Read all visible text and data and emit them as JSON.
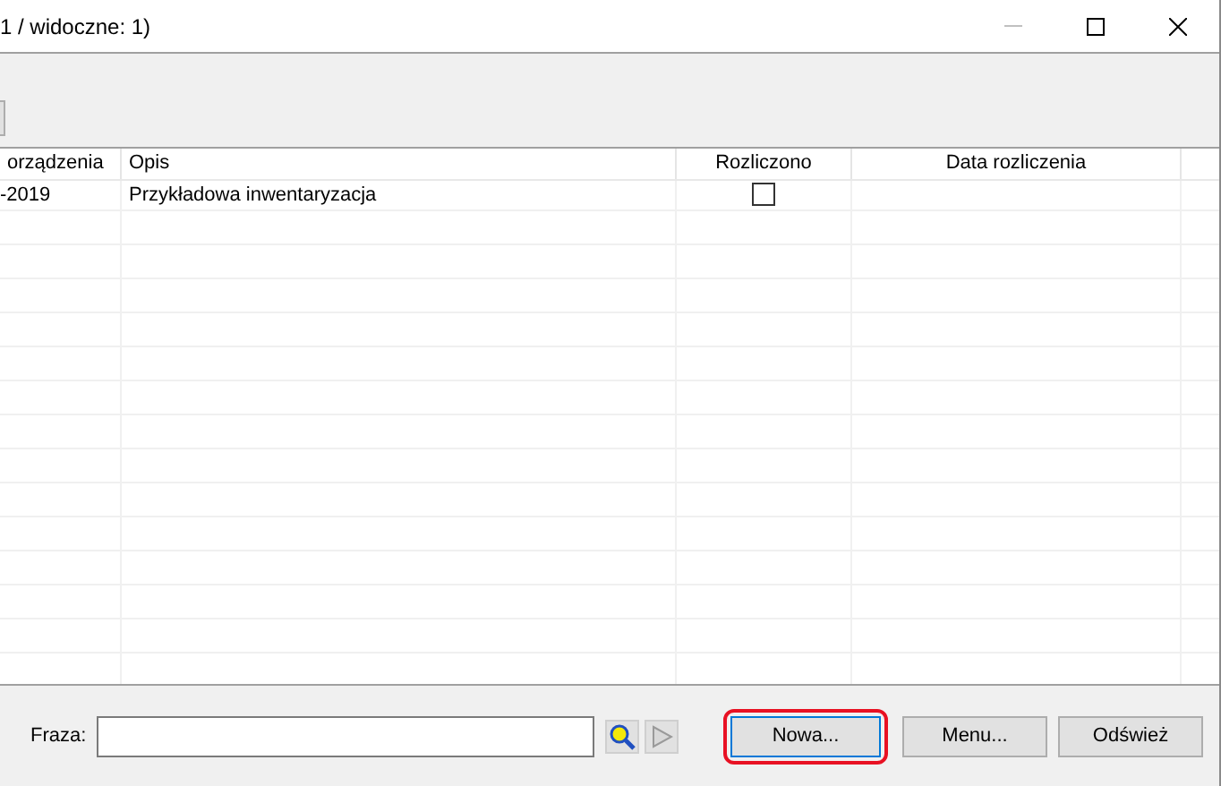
{
  "window": {
    "title": "1 / widoczne: 1)"
  },
  "table": {
    "columns": [
      "orządzenia",
      "Opis",
      "Rozliczono",
      "Data rozliczenia"
    ],
    "rows": [
      {
        "cells": [
          "-2019",
          "Przykładowa inwentaryzacja"
        ],
        "checked": false
      }
    ]
  },
  "search": {
    "label": "Fraza:"
  },
  "buttons": [
    {
      "label": "Nowa...",
      "highlighted": true
    },
    {
      "label": "Menu...",
      "highlighted": false
    },
    {
      "label": "Odśwież",
      "highlighted": false
    }
  ]
}
